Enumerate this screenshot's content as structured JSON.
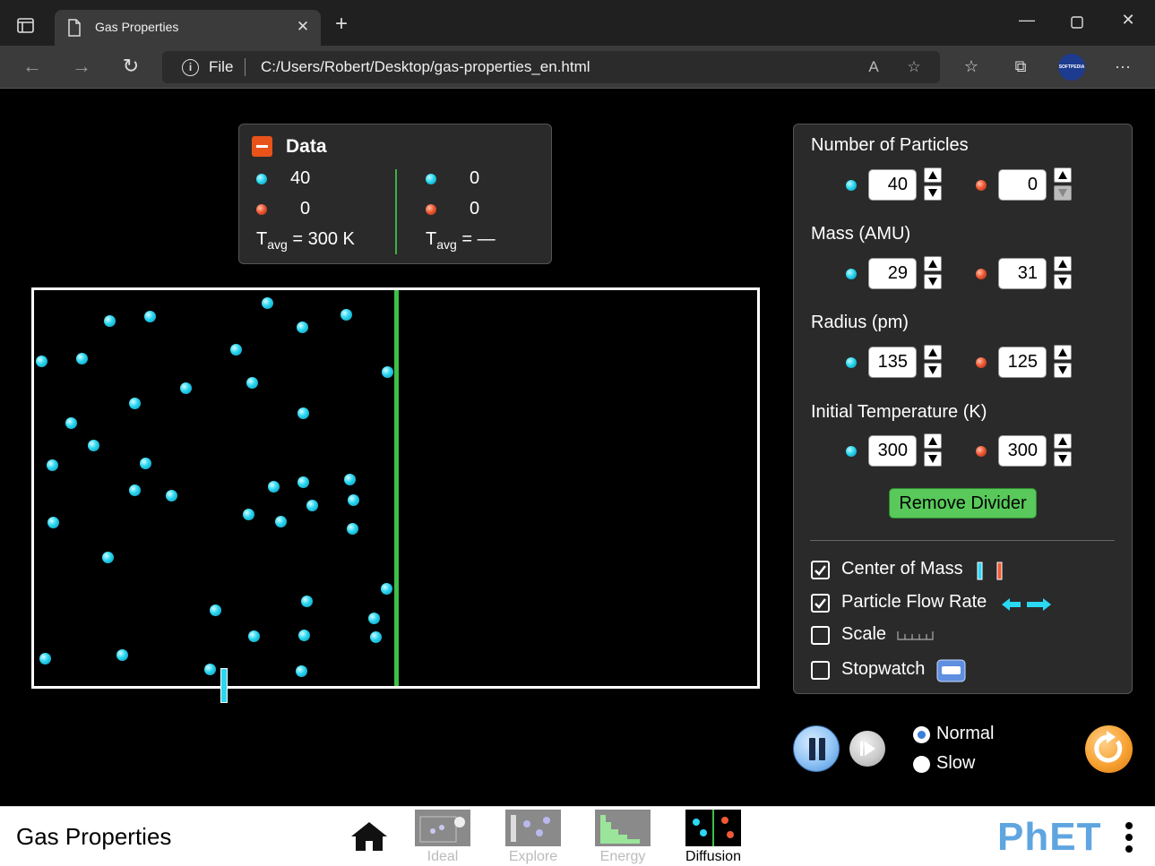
{
  "browser": {
    "tab_title": "Gas Properties",
    "address_scheme": "File",
    "address_url": "C:/Users/Robert/Desktop/gas-properties_en.html",
    "profile_label": "SOFTPEDIA",
    "icons": [
      "sidebar-icon",
      "page-icon",
      "close-icon",
      "plus-icon",
      "minimize-icon",
      "maximize-icon",
      "close-window-icon",
      "back-icon",
      "forward-icon",
      "refresh-icon",
      "info-icon",
      "read-aloud-icon",
      "favorite-add-icon",
      "favorites-icon",
      "collections-icon",
      "more-icon"
    ]
  },
  "data_panel": {
    "title": "Data",
    "left": {
      "blue_count": "40",
      "red_count": "0",
      "tavg_prefix": "T",
      "tavg_sub": "avg",
      "tavg_value": " = 300 K"
    },
    "right": {
      "blue_count": "0",
      "red_count": "0",
      "tavg_prefix": "T",
      "tavg_sub": "avg",
      "tavg_value": " = —"
    }
  },
  "controls": {
    "particles_label": "Number of Particles",
    "particles_blue": "40",
    "particles_red": "0",
    "mass_label": "Mass (AMU)",
    "mass_blue": "29",
    "mass_red": "31",
    "radius_label": "Radius (pm)",
    "radius_blue": "135",
    "radius_red": "125",
    "temp_label": "Initial Temperature (K)",
    "temp_blue": "300",
    "temp_red": "300",
    "remove_divider": "Remove Divider",
    "checks": {
      "center_of_mass": {
        "label": "Center of Mass",
        "checked": true
      },
      "flow_rate": {
        "label": "Particle Flow Rate",
        "checked": true
      },
      "scale": {
        "label": "Scale",
        "checked": false
      },
      "stopwatch": {
        "label": "Stopwatch",
        "checked": false
      }
    }
  },
  "playback": {
    "speed_normal": "Normal",
    "speed_slow": "Slow",
    "selected_speed": "Normal",
    "playing": true
  },
  "colors": {
    "blue_particle": "#2ad8f2",
    "red_particle": "#f05a36",
    "divider": "#3cc147",
    "remove_button": "#58c95a",
    "reset_button": "#f7a233"
  },
  "navbar": {
    "sim_title": "Gas Properties",
    "screens": [
      "Ideal",
      "Explore",
      "Energy",
      "Diffusion"
    ],
    "active_screen": "Diffusion",
    "logo": "PhET"
  }
}
